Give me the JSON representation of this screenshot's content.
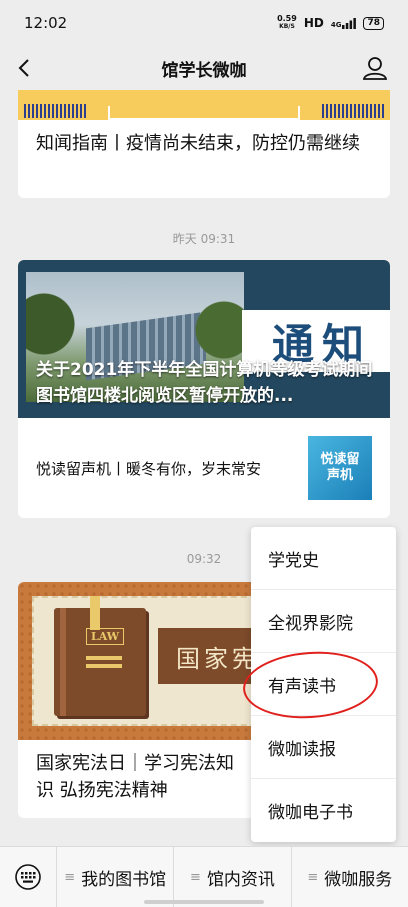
{
  "status": {
    "time": "12:02",
    "net_speed_value": "0.59",
    "net_speed_unit": "KB/S",
    "hd": "HD",
    "signal": "4G",
    "battery": "78"
  },
  "nav": {
    "title": "馆学长微咖"
  },
  "messages": [
    {
      "title": "知闻指南丨疫情尚未结束，防控仍需继续"
    },
    {
      "timestamp": "昨天 09:31",
      "hero_title": "关于2021年下半年全国计算机等级考试期间图书馆四楼北阅览区暂停开放的...",
      "hero_badge": "通知",
      "sub_title": "悦读留声机丨暖冬有你，岁末常安",
      "thumb_label": "悦读留声机"
    },
    {
      "timestamp": "09:32",
      "book_label": "LAW",
      "plaque_text": "国家宪",
      "title": "国家宪法日｜学习宪法知识 弘扬宪法精神"
    }
  ],
  "popup_menu": {
    "items": [
      "学党史",
      "全视界影院",
      "有声读书",
      "微咖读报",
      "微咖电子书"
    ],
    "highlighted_index": 2
  },
  "bottom_menu": {
    "items": [
      "我的图书馆",
      "馆内资讯",
      "微咖服务"
    ]
  },
  "colors": {
    "highlight_circle": "#e0201c",
    "background": "#ededed"
  }
}
